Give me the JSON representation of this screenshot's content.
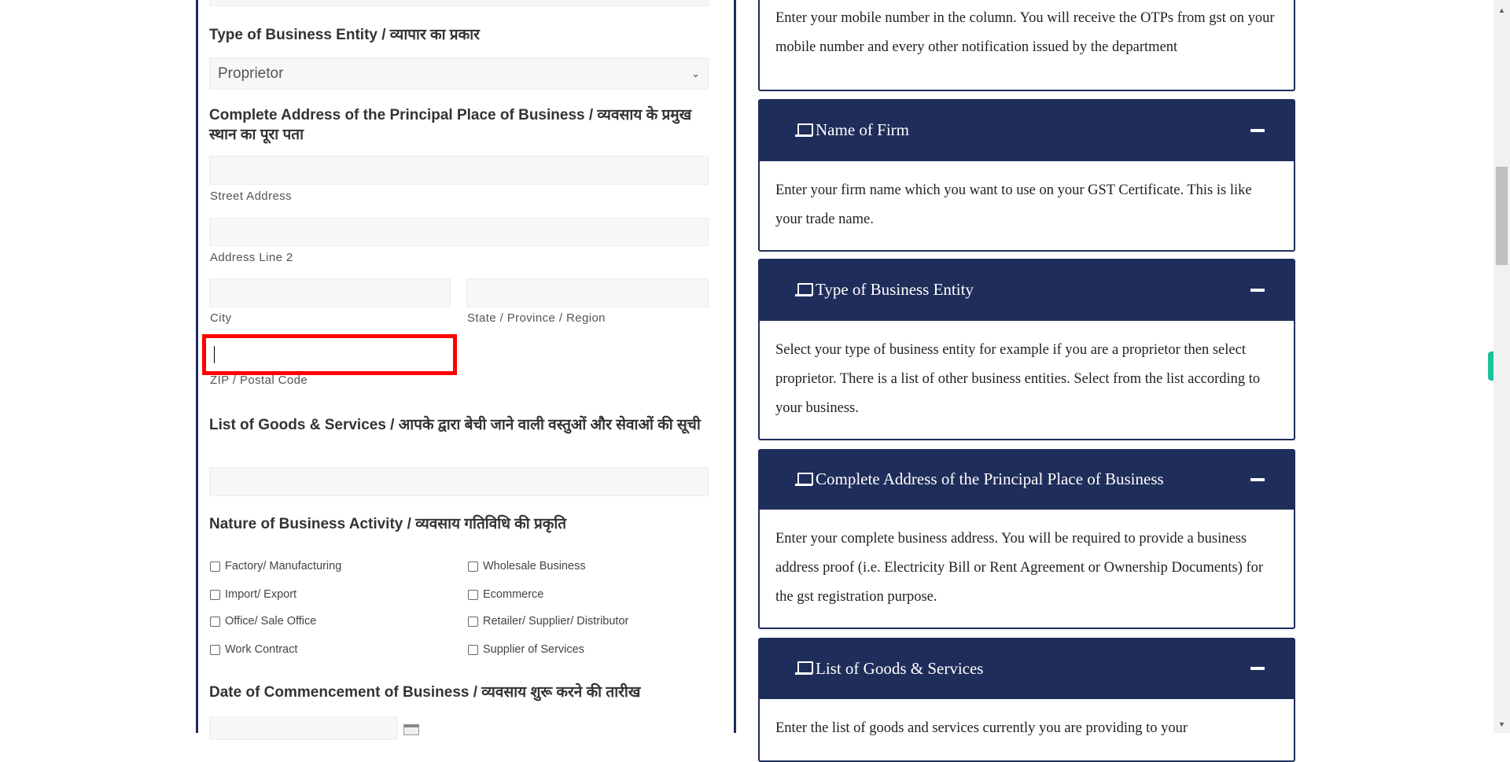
{
  "form": {
    "business_type_heading": "Type of Business Entity / व्यापार का प्रकार",
    "business_type_value": "Proprietor",
    "address_heading": "Complete Address of the Principal Place of Business / व्यवसाय के प्रमुख स्थान का पूरा पता",
    "street_label": "Street Address",
    "address2_label": "Address Line 2",
    "city_label": "City",
    "state_label": "State / Province / Region",
    "zip_label": "ZIP / Postal Code",
    "goods_heading": "List of Goods & Services / आपके द्वारा बेची जाने वाली वस्तुओं और सेवाओं की सूची",
    "nature_heading": "Nature of Business Activity / व्यवसाय गतिविधि की प्रकृति",
    "activities": [
      "Factory/ Manufacturing",
      "Wholesale Business",
      "Import/ Export",
      "Ecommerce",
      "Office/ Sale Office",
      "Retailer/ Supplier/ Distributor",
      "Work Contract",
      "Supplier of Services"
    ],
    "date_heading": "Date of Commencement of Business / व्यवसाय शुरू करने की तारीख"
  },
  "help": {
    "mobile_text": "Enter your mobile number in the column. You will receive the OTPs from gst on your mobile number and every other notification issued by the department",
    "cards": [
      {
        "title": "Name of Firm",
        "text": "Enter your firm name which you want to use on your GST Certificate. This is like your trade name."
      },
      {
        "title": "Type of Business Entity",
        "text": "Select your type of business entity for example if you are a proprietor then select proprietor. There is a list of other business entities. Select from the list according to your business."
      },
      {
        "title": "Complete Address of the Principal Place of Business",
        "text": "Enter your complete business address. You will be required to provide a business address proof (i.e. Electricity Bill or Rent Agreement or Ownership Documents) for the gst registration purpose."
      },
      {
        "title": "List of Goods & Services",
        "text": "Enter the list of goods and services currently you are providing to your"
      }
    ]
  },
  "colors": {
    "header": "#1f2d5a",
    "highlight": "#ff0000"
  }
}
